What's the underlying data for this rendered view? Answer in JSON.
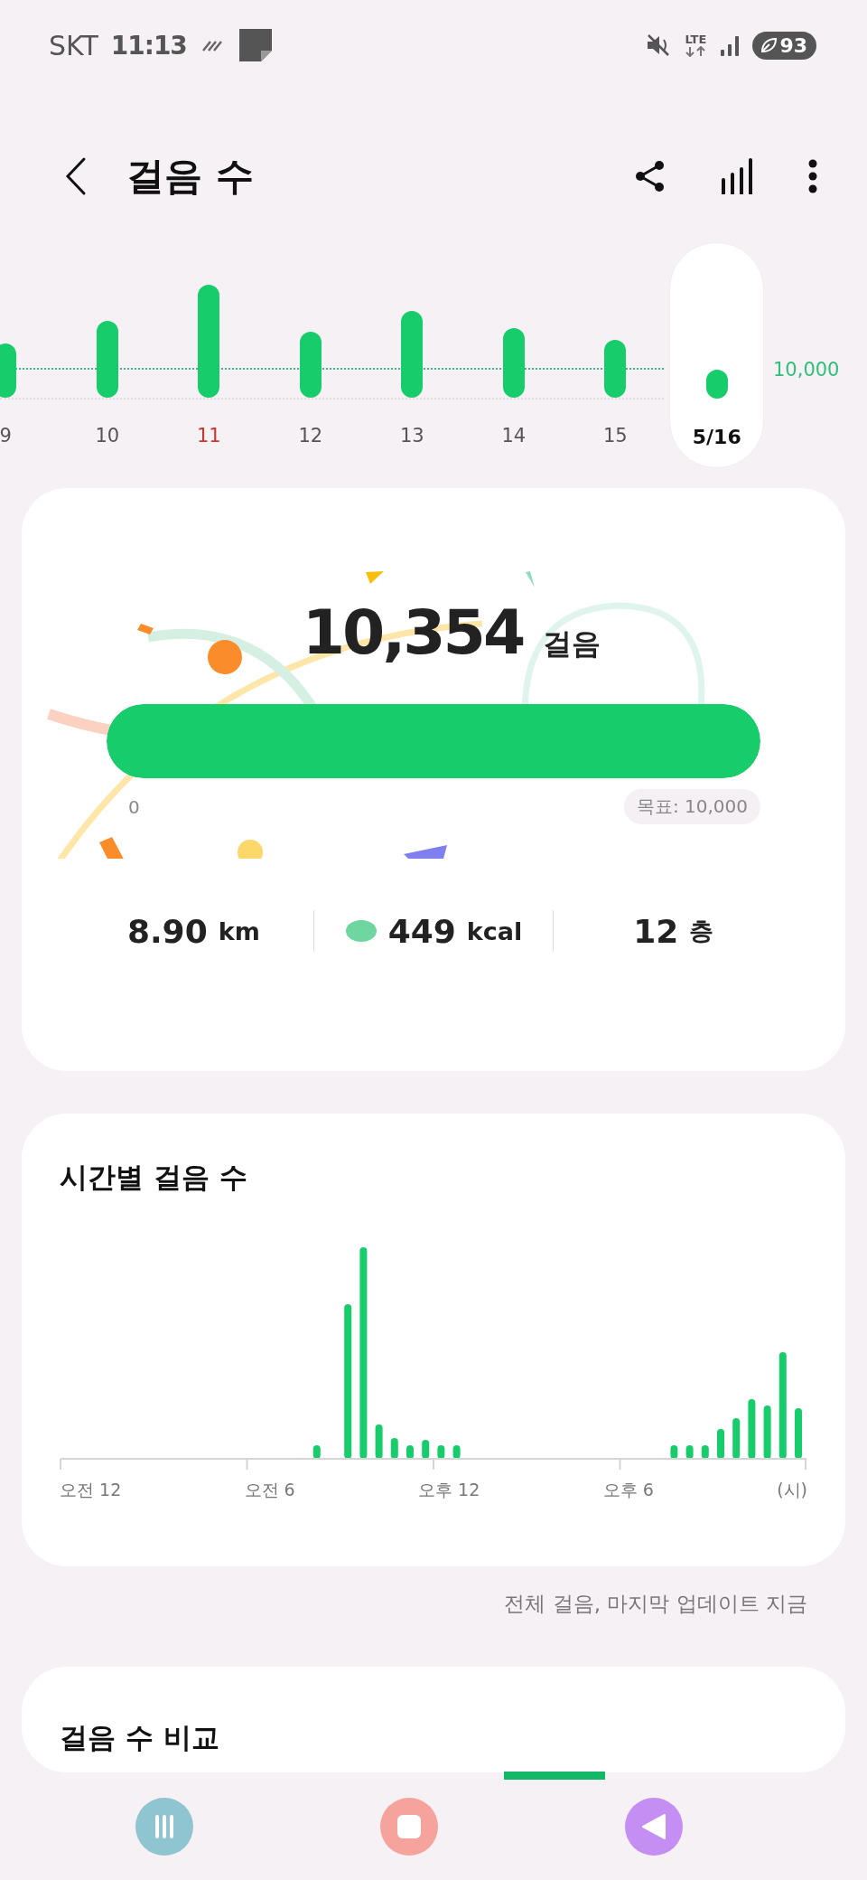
{
  "status_bar": {
    "carrier": "SKT",
    "time": "11:13",
    "network": "LTE",
    "battery": "93"
  },
  "header": {
    "title": "걸음 수"
  },
  "week": {
    "goal_label": "10,000",
    "days": [
      {
        "label": "9",
        "selected": false,
        "holiday": false
      },
      {
        "label": "10",
        "selected": false,
        "holiday": false
      },
      {
        "label": "11",
        "selected": false,
        "holiday": true
      },
      {
        "label": "12",
        "selected": false,
        "holiday": false
      },
      {
        "label": "13",
        "selected": false,
        "holiday": false
      },
      {
        "label": "14",
        "selected": false,
        "holiday": false
      },
      {
        "label": "15",
        "selected": false,
        "holiday": false
      },
      {
        "label": "5/16",
        "selected": true,
        "holiday": false
      }
    ]
  },
  "summary": {
    "steps": "10,354",
    "unit": "걸음",
    "progress": {
      "level": 1,
      "start": "0",
      "goal": "목표: 10,000"
    },
    "stats": [
      {
        "kind": "distance",
        "value": "8.90",
        "unit": "km"
      },
      {
        "kind": "calories",
        "value": "449",
        "unit": "kcal"
      },
      {
        "kind": "floors",
        "value": "12",
        "unit": "층"
      }
    ]
  },
  "hourly": {
    "title": "시간별 걸음 수",
    "axis_labels": [
      "오전 12",
      "오전 6",
      "오후 12",
      "오후 6",
      "(시)"
    ]
  },
  "update_note": "전체 걸음, 마지막 업데이트 지금",
  "compare": {
    "title": "걸음 수 비교"
  }
}
